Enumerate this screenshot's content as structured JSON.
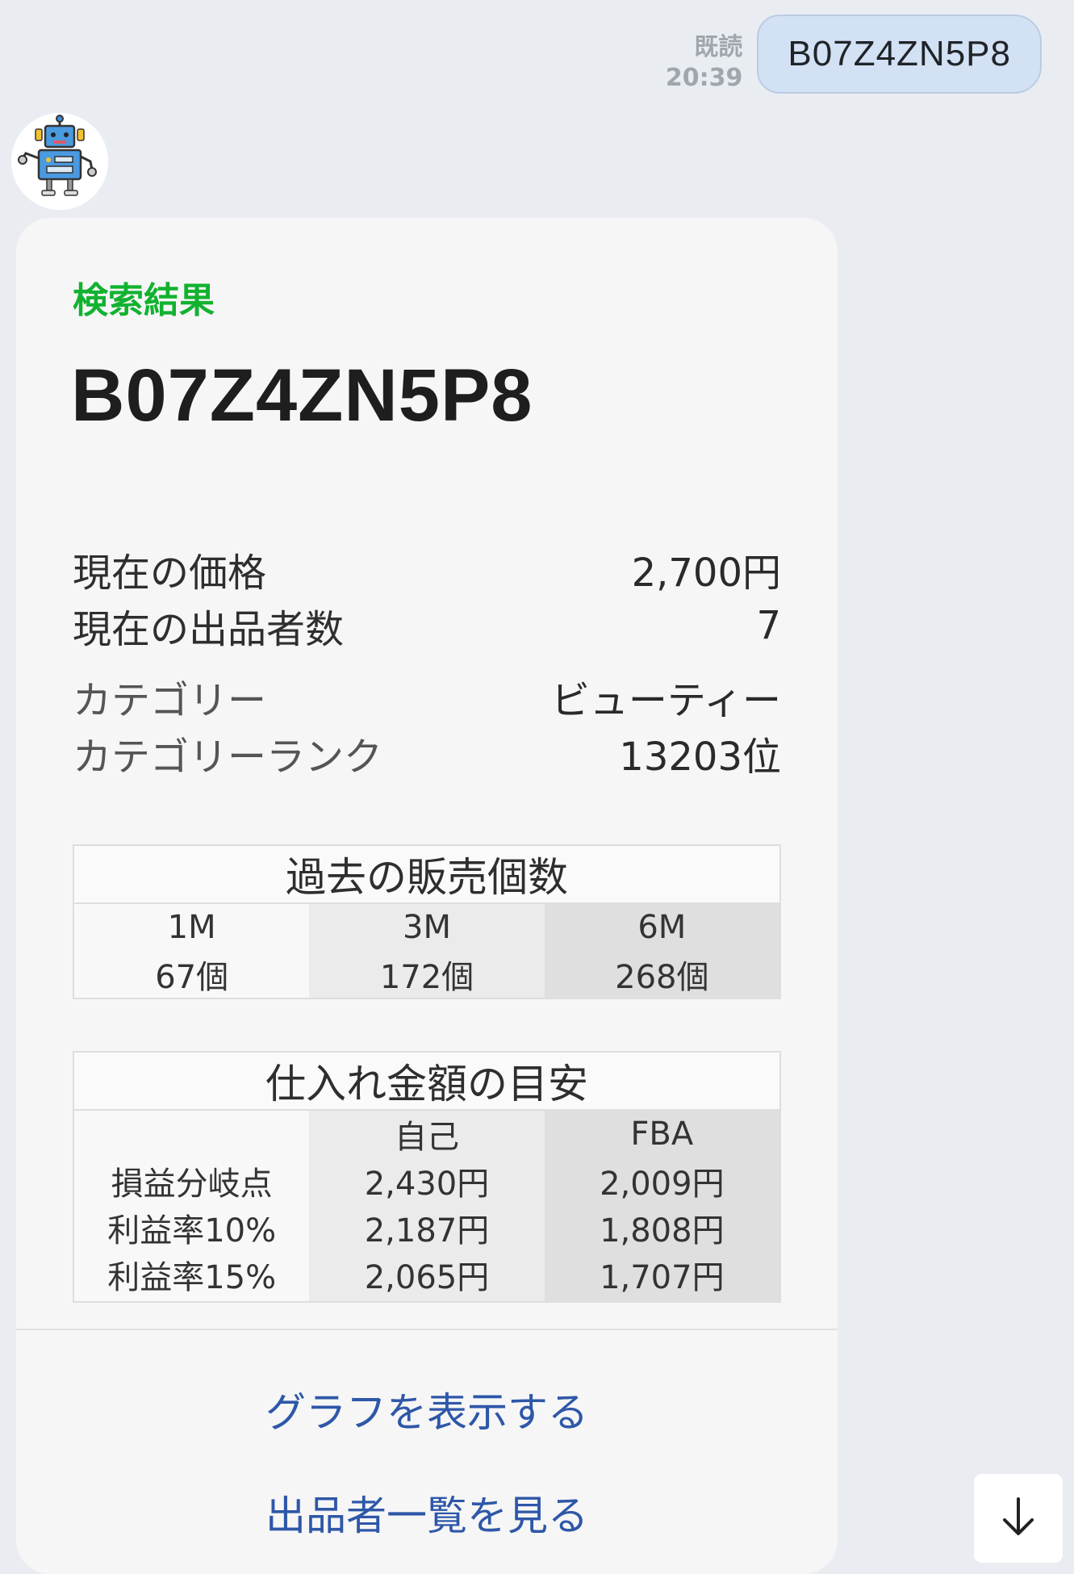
{
  "outgoing": {
    "read_label": "既読",
    "time": "20:39",
    "text": "B07Z4ZN5P8"
  },
  "card": {
    "kicker": "検索結果",
    "title": "B07Z4ZN5P8",
    "details": [
      {
        "label": "現在の価格",
        "value": "2,700円"
      },
      {
        "label": "現在の出品者数",
        "value": "7"
      },
      {
        "label": "カテゴリー",
        "value": "ビューティー"
      },
      {
        "label": "カテゴリーランク",
        "value": "13203位"
      }
    ],
    "sales": {
      "title": "過去の販売個数",
      "periods": [
        {
          "label": "1M",
          "value": "67個"
        },
        {
          "label": "3M",
          "value": "172個"
        },
        {
          "label": "6M",
          "value": "268個"
        }
      ]
    },
    "purchase": {
      "title": "仕入れ金額の目安",
      "columns": [
        "自己",
        "FBA"
      ],
      "rows": [
        {
          "label": "損益分岐点",
          "self": "2,430円",
          "fba": "2,009円"
        },
        {
          "label": "利益率10%",
          "self": "2,187円",
          "fba": "1,808円"
        },
        {
          "label": "利益率15%",
          "self": "2,065円",
          "fba": "1,707円"
        }
      ]
    },
    "actions": {
      "graph": "グラフを表示する",
      "sellers": "出品者一覧を見る"
    }
  },
  "icons": {
    "avatar": "robot-avatar-icon",
    "scroll": "arrow-down-icon"
  }
}
